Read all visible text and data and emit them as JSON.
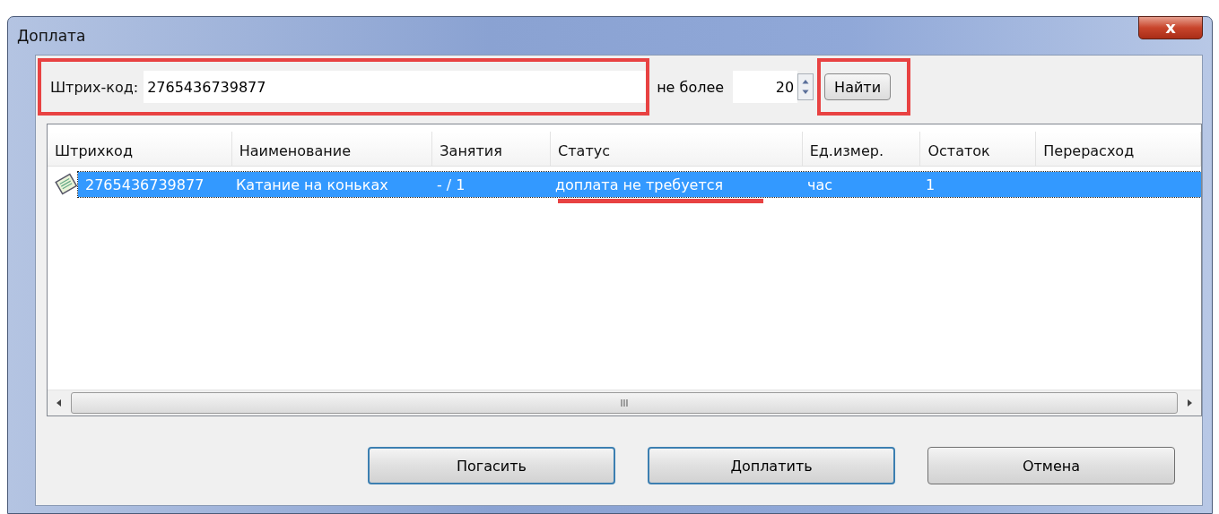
{
  "window": {
    "title": "Доплата",
    "close_glyph": "x"
  },
  "search": {
    "label": "Штрих-код:",
    "value": "2765436739877"
  },
  "limit": {
    "label": "не более",
    "value": "20"
  },
  "find_button": "Найти",
  "table": {
    "columns": [
      "Штрихкод",
      "Наименование",
      "Занятия",
      "Статус",
      "Ед.измер.",
      "Остаток",
      "Перерасход"
    ],
    "rows": [
      {
        "cells": [
          "2765436739877",
          "Катание на коньках",
          "- / 1",
          "доплата не требуется",
          "час",
          "1",
          ""
        ],
        "selected": true
      }
    ],
    "scroll_glyph": "III"
  },
  "buttons": [
    "Погасить",
    "Доплатить",
    "Отмена"
  ]
}
